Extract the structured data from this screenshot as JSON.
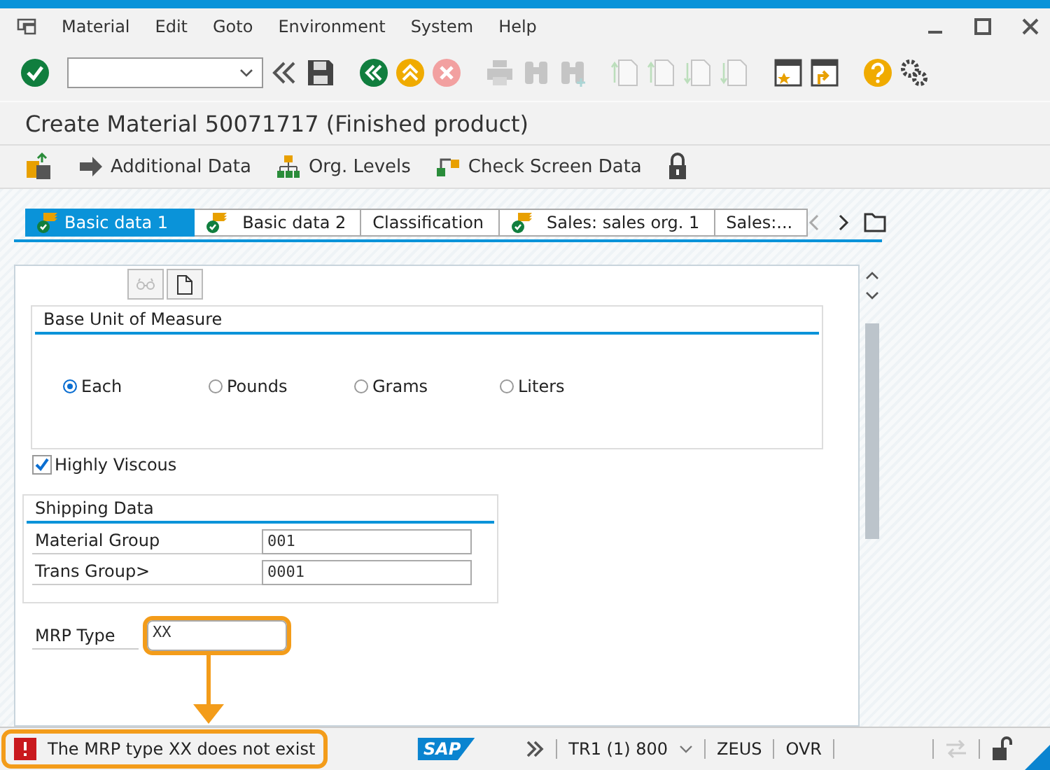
{
  "menu": [
    "Material",
    "Edit",
    "Goto",
    "Environment",
    "System",
    "Help"
  ],
  "toolbar": [
    {
      "kind": "enter",
      "disabled": false
    },
    {
      "kind": "command",
      "disabled": false
    },
    {
      "kind": "collapse",
      "disabled": false
    },
    {
      "kind": "save",
      "disabled": false
    },
    {
      "kind": "back",
      "disabled": false
    },
    {
      "kind": "exit",
      "disabled": false
    },
    {
      "kind": "cancel",
      "disabled": false
    },
    {
      "kind": "print",
      "disabled": true
    },
    {
      "kind": "find",
      "disabled": true
    },
    {
      "kind": "find-next",
      "disabled": true
    },
    {
      "kind": "first-page",
      "disabled": true
    },
    {
      "kind": "prev-page",
      "disabled": true
    },
    {
      "kind": "next-page",
      "disabled": true
    },
    {
      "kind": "last-page",
      "disabled": true
    },
    {
      "kind": "new-session",
      "disabled": false
    },
    {
      "kind": "shortcut",
      "disabled": false
    },
    {
      "kind": "help",
      "disabled": false
    },
    {
      "kind": "settings",
      "disabled": false
    }
  ],
  "title": "Create Material 50071717 (Finished product)",
  "app_toolbar": [
    {
      "kind": "views"
    },
    {
      "kind": "arrow",
      "label": "Additional Data"
    },
    {
      "kind": "hierarchy",
      "label": "Org. Levels"
    },
    {
      "kind": "check",
      "label": "Check Screen Data"
    },
    {
      "kind": "lock"
    }
  ],
  "tabs": [
    {
      "label": "Basic data 1",
      "selected": true,
      "complete": true
    },
    {
      "label": "Basic data 2",
      "selected": false,
      "complete": true
    },
    {
      "label": "Classification",
      "selected": false,
      "complete": false
    },
    {
      "label": "Sales: sales org. 1",
      "selected": false,
      "complete": true
    },
    {
      "label": "Sales:...",
      "selected": false,
      "complete": false
    }
  ],
  "base_unit": {
    "title": "Base Unit of Measure",
    "options": [
      {
        "label": "Each",
        "selected": true
      },
      {
        "label": "Pounds",
        "selected": false
      },
      {
        "label": "Grams",
        "selected": false
      },
      {
        "label": "Liters",
        "selected": false
      }
    ]
  },
  "highly_viscous": {
    "label": "Highly Viscous",
    "checked": true
  },
  "shipping": {
    "title": "Shipping Data",
    "fields": [
      {
        "label": "Material Group",
        "value": "001"
      },
      {
        "label": "Trans Group>",
        "value": "0001"
      }
    ]
  },
  "mrp_type": {
    "label": "MRP Type",
    "value": "XX",
    "highlighted": true
  },
  "status_bar": {
    "message": {
      "kind": "error",
      "text": "The MRP type XX does not exist",
      "highlighted": true
    },
    "logo": "SAP",
    "system": "TR1 (1) 800",
    "user": "ZEUS",
    "mode": "OVR"
  }
}
